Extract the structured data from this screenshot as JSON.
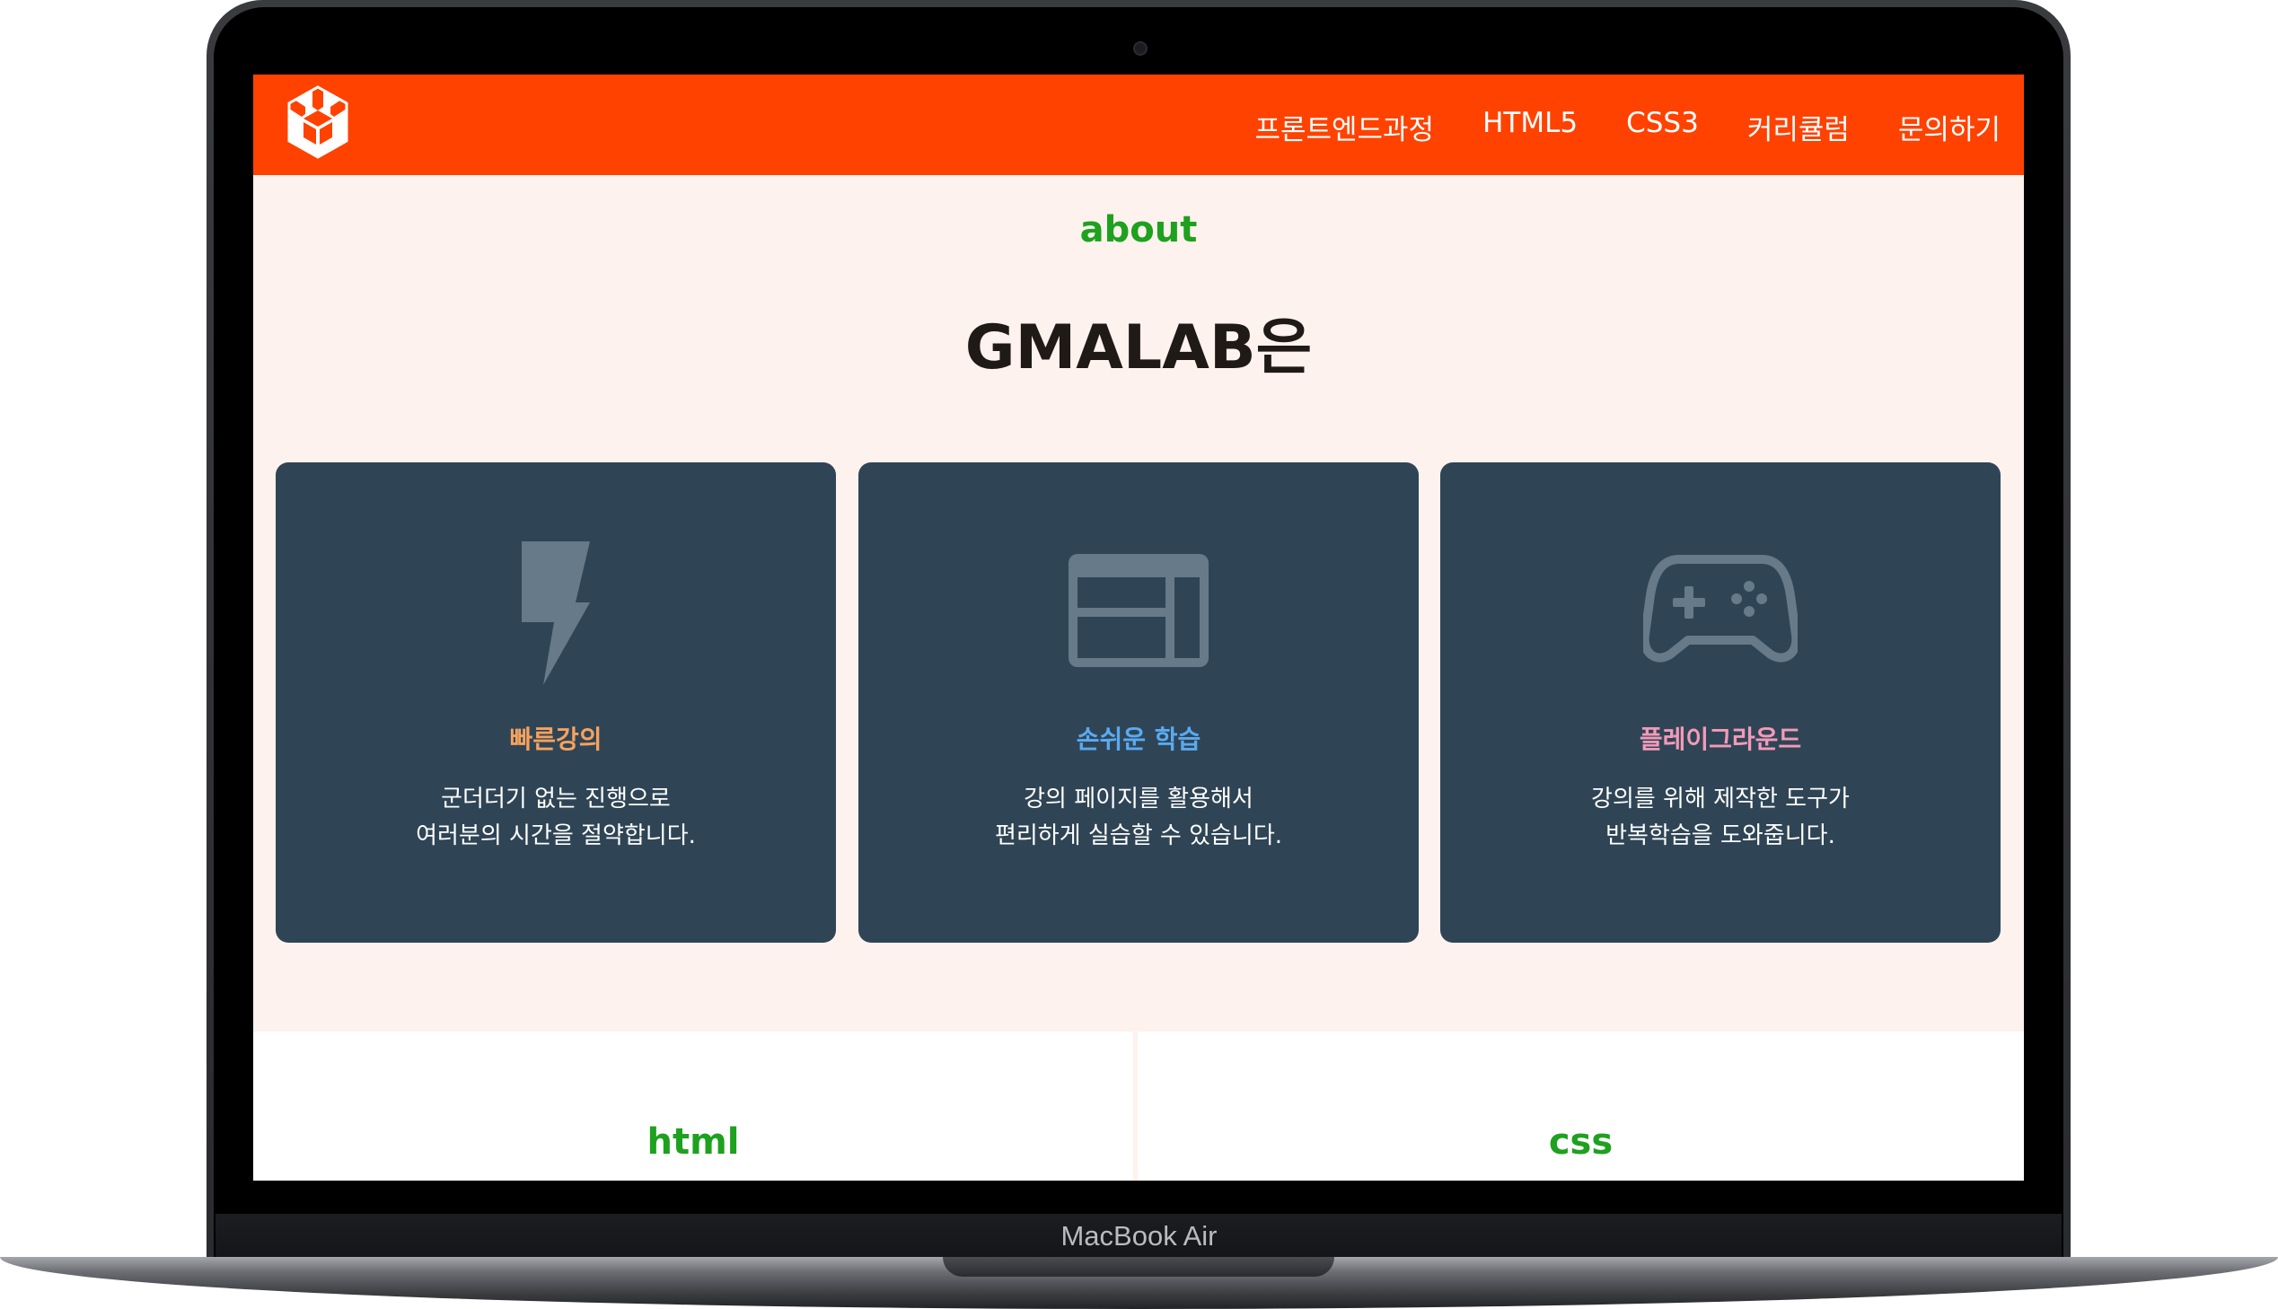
{
  "device": {
    "label": "MacBook Air"
  },
  "nav": {
    "items": [
      {
        "label": "프론트엔드과정"
      },
      {
        "label": "HTML5"
      },
      {
        "label": "CSS3"
      },
      {
        "label": "커리큘럼"
      },
      {
        "label": "문의하기"
      }
    ]
  },
  "about": {
    "label": "about",
    "title": "GMALAB은"
  },
  "cards": [
    {
      "icon": "lightning-icon",
      "title": "빠른강의",
      "title_color": "#f6a25e",
      "desc": [
        "군더더기 없는 진행으로",
        "여러분의 시간을 절약합니다."
      ]
    },
    {
      "icon": "browser-window-icon",
      "title": "손쉬운 학습",
      "title_color": "#5aaaf0",
      "desc": [
        "강의 페이지를 활용해서",
        "편리하게 실습할 수 있습니다."
      ]
    },
    {
      "icon": "gamepad-icon",
      "title": "플레이그라운드",
      "title_color": "#f39ab8",
      "desc": [
        "강의를 위해 제작한 도구가",
        "반복학습을 도와줍니다."
      ]
    }
  ],
  "sections": [
    {
      "label": "html"
    },
    {
      "label": "css"
    }
  ],
  "colors": {
    "nav_bg": "#ff4200",
    "page_bg": "#fdf2ee",
    "card_bg": "#2f4556",
    "section_label": "#1ea11e",
    "title_text": "#1f1a16",
    "icon_gray": "#667a89"
  }
}
